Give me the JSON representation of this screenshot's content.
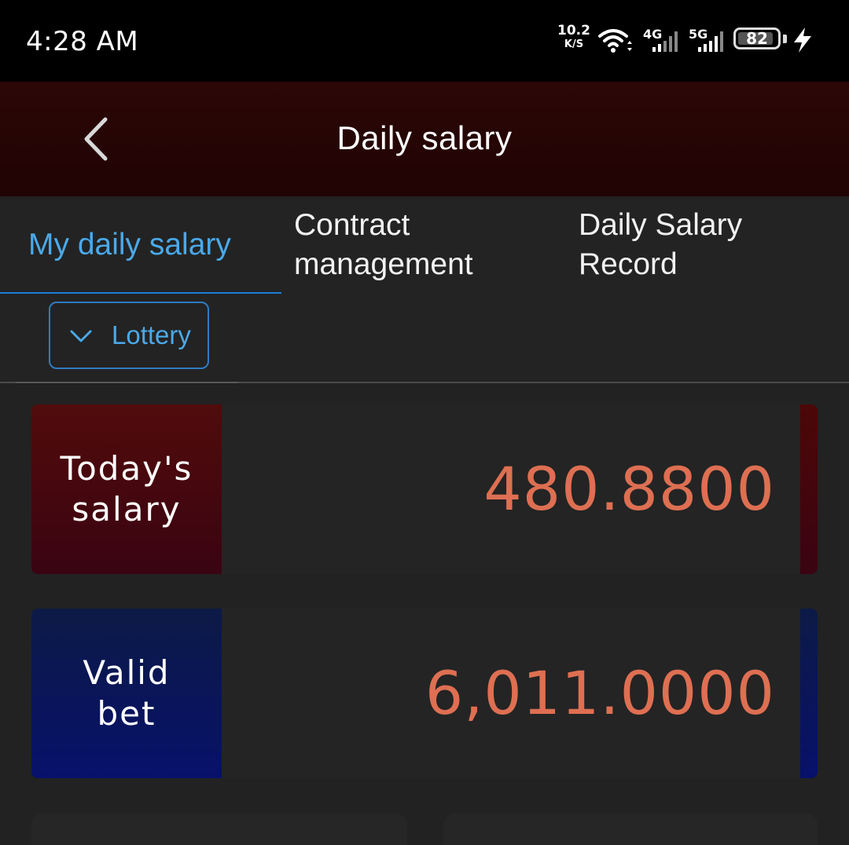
{
  "status_bar": {
    "time": "4:28 AM",
    "net_speed_value": "10.2",
    "net_speed_unit": "K/S",
    "signal_4g_label": "4G",
    "signal_5g_label": "5G",
    "battery_level": "82",
    "icons": [
      "wifi-icon",
      "signal-4g-icon",
      "signal-5g-icon",
      "battery-icon",
      "charging-icon"
    ]
  },
  "header": {
    "title": "Daily salary",
    "back_icon": "chevron-left-icon"
  },
  "tabs": [
    {
      "label": "My daily salary",
      "active": true
    },
    {
      "label_line1": "Contract",
      "label_line2": "management",
      "active": false
    },
    {
      "label_line1": "Daily Salary",
      "label_line2": "Record",
      "active": false
    }
  ],
  "filter": {
    "selected": "Lottery",
    "icon": "chevron-down-icon"
  },
  "cards": [
    {
      "label_line1": "Today's",
      "label_line2": "salary",
      "value": "480.8800"
    },
    {
      "label_line1": "Valid",
      "label_line2": "bet",
      "value": "6,011.0000"
    }
  ],
  "colors": {
    "accent_blue": "#4aa9e9",
    "tab_underline": "#1c7ed6",
    "value_orange": "#de6f52",
    "header_bg": "#240404",
    "salary_card": "#4a0a10",
    "bet_card": "#0a1656"
  }
}
